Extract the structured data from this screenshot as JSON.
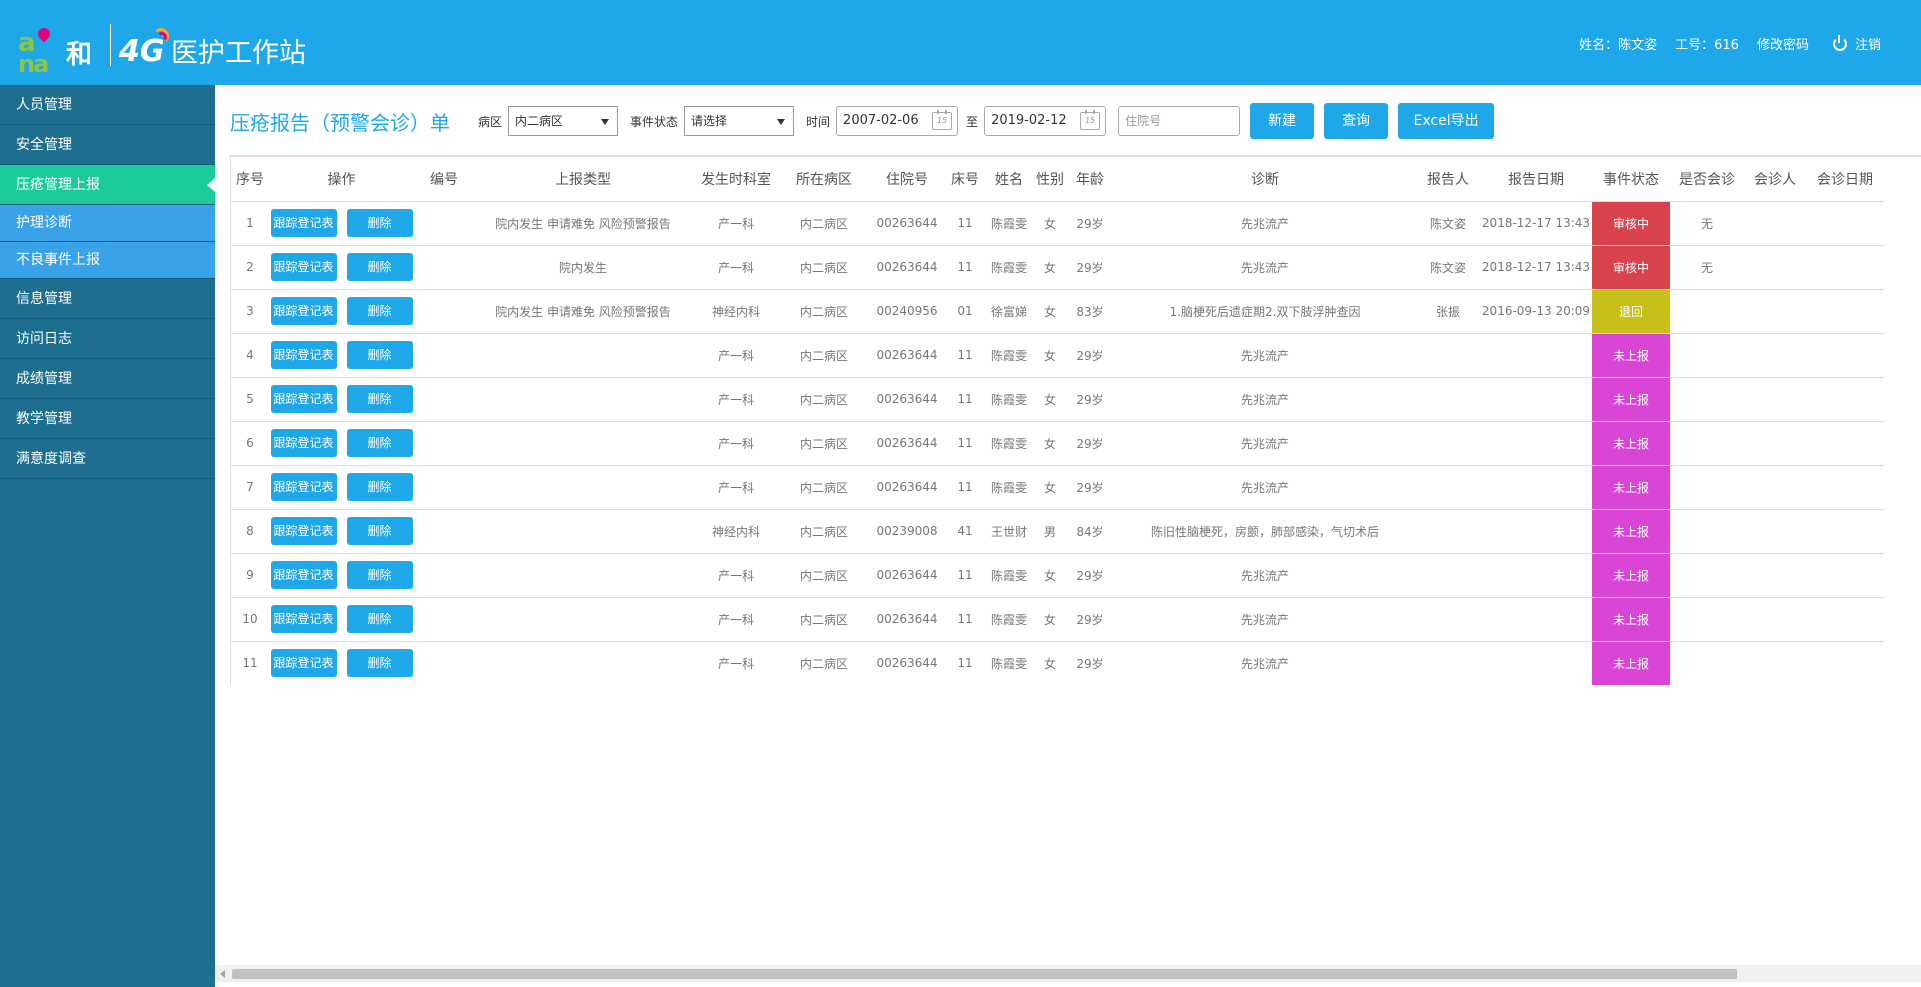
{
  "header": {
    "logo_and": "and",
    "logo_he": "和",
    "logo_4g": "4G",
    "app_title": "医护工作站",
    "user_name": "姓名：陈文姿",
    "work_id": "工号：616",
    "change_password": "修改密码",
    "logout": "注销"
  },
  "sidebar": {
    "items": [
      {
        "label": "人员管理"
      },
      {
        "label": "安全管理"
      },
      {
        "label": "压疮管理上报"
      },
      {
        "label": "护理诊断"
      },
      {
        "label": "不良事件上报"
      },
      {
        "label": "信息管理"
      },
      {
        "label": "访问日志"
      },
      {
        "label": "成绩管理"
      },
      {
        "label": "教学管理"
      },
      {
        "label": "满意度调查"
      }
    ]
  },
  "toolbar": {
    "page_title": "压疮报告（预警会诊）单",
    "ward_label": "病区",
    "ward_value": "内二病区",
    "status_label": "事件状态",
    "status_value": "请选择",
    "time_label": "时间",
    "date_from": "2007-02-06",
    "to_label": "至",
    "date_to": "2019-02-12",
    "calendar_day": "15",
    "admission_placeholder": "住院号",
    "new_label": "新建",
    "query_label": "查询",
    "export_label": "Excel导出"
  },
  "table": {
    "headers": {
      "seq": "序号",
      "ops": "操作",
      "code": "编号",
      "report_type": "上报类型",
      "dept": "发生时科室",
      "ward": "所在病区",
      "admission_no": "住院号",
      "bed": "床号",
      "name": "姓名",
      "gender": "性别",
      "age": "年龄",
      "diagnosis": "诊断",
      "reporter": "报告人",
      "report_date": "报告日期",
      "status": "事件状态",
      "consult": "是否会诊",
      "consultant": "会诊人",
      "consult_date": "会诊日期"
    },
    "track_label": "跟踪登记表",
    "delete_label": "删除",
    "rows": [
      {
        "seq": "1",
        "code": "",
        "type": "院内发生 申请难免 风险预警报告",
        "dept": "产一科",
        "ward": "内二病区",
        "adm": "00263644",
        "bed": "11",
        "name": "陈霞雯",
        "gender": "女",
        "age": "29岁",
        "diag": "先兆流产",
        "reporter": "陈文姿",
        "date": "2018-12-17 13:43",
        "status": "审核中",
        "consult": "无",
        "consultant": "",
        "cdate": ""
      },
      {
        "seq": "2",
        "code": "",
        "type": "院内发生",
        "dept": "产一科",
        "ward": "内二病区",
        "adm": "00263644",
        "bed": "11",
        "name": "陈霞雯",
        "gender": "女",
        "age": "29岁",
        "diag": "先兆流产",
        "reporter": "陈文姿",
        "date": "2018-12-17 13:43",
        "status": "审核中",
        "consult": "无",
        "consultant": "",
        "cdate": ""
      },
      {
        "seq": "3",
        "code": "",
        "type": "院内发生 申请难免 风险预警报告",
        "dept": "神经内科",
        "ward": "内二病区",
        "adm": "00240956",
        "bed": "01",
        "name": "徐富娣",
        "gender": "女",
        "age": "83岁",
        "diag": "1.脑梗死后遗症期2.双下肢浮肿查因",
        "reporter": "张振",
        "date": "2016-09-13 20:09",
        "status": "退回",
        "consult": "",
        "consultant": "",
        "cdate": ""
      },
      {
        "seq": "4",
        "code": "",
        "type": "",
        "dept": "产一科",
        "ward": "内二病区",
        "adm": "00263644",
        "bed": "11",
        "name": "陈霞雯",
        "gender": "女",
        "age": "29岁",
        "diag": "先兆流产",
        "reporter": "",
        "date": "",
        "status": "未上报",
        "consult": "",
        "consultant": "",
        "cdate": ""
      },
      {
        "seq": "5",
        "code": "",
        "type": "",
        "dept": "产一科",
        "ward": "内二病区",
        "adm": "00263644",
        "bed": "11",
        "name": "陈霞雯",
        "gender": "女",
        "age": "29岁",
        "diag": "先兆流产",
        "reporter": "",
        "date": "",
        "status": "未上报",
        "consult": "",
        "consultant": "",
        "cdate": ""
      },
      {
        "seq": "6",
        "code": "",
        "type": "",
        "dept": "产一科",
        "ward": "内二病区",
        "adm": "00263644",
        "bed": "11",
        "name": "陈霞雯",
        "gender": "女",
        "age": "29岁",
        "diag": "先兆流产",
        "reporter": "",
        "date": "",
        "status": "未上报",
        "consult": "",
        "consultant": "",
        "cdate": ""
      },
      {
        "seq": "7",
        "code": "",
        "type": "",
        "dept": "产一科",
        "ward": "内二病区",
        "adm": "00263644",
        "bed": "11",
        "name": "陈霞雯",
        "gender": "女",
        "age": "29岁",
        "diag": "先兆流产",
        "reporter": "",
        "date": "",
        "status": "未上报",
        "consult": "",
        "consultant": "",
        "cdate": ""
      },
      {
        "seq": "8",
        "code": "",
        "type": "",
        "dept": "神经内科",
        "ward": "内二病区",
        "adm": "00239008",
        "bed": "41",
        "name": "王世财",
        "gender": "男",
        "age": "84岁",
        "diag": "陈旧性脑梗死，房颤，肺部感染，气切术后",
        "reporter": "",
        "date": "",
        "status": "未上报",
        "consult": "",
        "consultant": "",
        "cdate": ""
      },
      {
        "seq": "9",
        "code": "",
        "type": "",
        "dept": "产一科",
        "ward": "内二病区",
        "adm": "00263644",
        "bed": "11",
        "name": "陈霞雯",
        "gender": "女",
        "age": "29岁",
        "diag": "先兆流产",
        "reporter": "",
        "date": "",
        "status": "未上报",
        "consult": "",
        "consultant": "",
        "cdate": ""
      },
      {
        "seq": "10",
        "code": "",
        "type": "",
        "dept": "产一科",
        "ward": "内二病区",
        "adm": "00263644",
        "bed": "11",
        "name": "陈霞雯",
        "gender": "女",
        "age": "29岁",
        "diag": "先兆流产",
        "reporter": "",
        "date": "",
        "status": "未上报",
        "consult": "",
        "consultant": "",
        "cdate": ""
      },
      {
        "seq": "11",
        "code": "",
        "type": "",
        "dept": "产一科",
        "ward": "内二病区",
        "adm": "00263644",
        "bed": "11",
        "name": "陈霞雯",
        "gender": "女",
        "age": "29岁",
        "diag": "先兆流产",
        "reporter": "",
        "date": "",
        "status": "未上报",
        "consult": "",
        "consultant": "",
        "cdate": ""
      }
    ]
  },
  "colors": {
    "header_bg": "#1ea8e9",
    "sidebar_bg": "#1d6e8f",
    "active_nav": "#1ccb9a",
    "sub_nav": "#3aa2e8",
    "status_review": "#d9434e",
    "status_return": "#c8c01a",
    "status_not_reported": "#d946d5"
  }
}
